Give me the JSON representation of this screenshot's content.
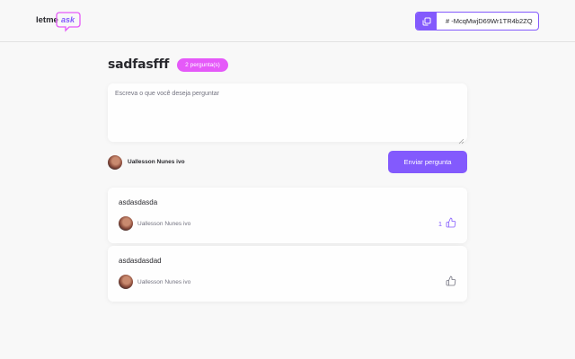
{
  "header": {
    "logo_text_1": "letme",
    "logo_text_2": "ask",
    "room_code": "# -McqMwjD69Wr1TR4b2ZQ"
  },
  "room": {
    "title": "sadfasfff",
    "question_count_badge": "2 pergunta(s)"
  },
  "form": {
    "placeholder": "Escreva o que você deseja perguntar",
    "user_name": "Uallesson Nunes ivo",
    "send_label": "Enviar pergunta"
  },
  "questions": [
    {
      "content": "asdasdasda",
      "author": "Uallesson Nunes ivo",
      "likes": "1"
    },
    {
      "content": "asdasdasdad",
      "author": "Uallesson Nunes ivo",
      "likes": ""
    }
  ],
  "colors": {
    "accent": "#835afd",
    "badge": "#e559f9",
    "background": "#f8f8f8"
  },
  "icons": [
    "copy-icon",
    "like-icon",
    "resize-grip-icon"
  ]
}
